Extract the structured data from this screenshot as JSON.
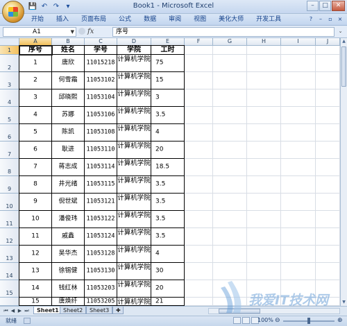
{
  "window": {
    "title": "Book1 - Microsoft Excel",
    "quick_access": [
      "save-icon",
      "undo-icon",
      "redo-icon"
    ],
    "controls": {
      "minimize": "–",
      "maximize": "□",
      "close": "✕"
    }
  },
  "ribbon": {
    "tabs": [
      "开始",
      "插入",
      "页面布局",
      "公式",
      "数据",
      "审阅",
      "视图",
      "美化大师",
      "开发工具"
    ]
  },
  "formula_bar": {
    "name_box": "A1",
    "fx_label": "fx",
    "content": "序号"
  },
  "columns": [
    "A",
    "B",
    "C",
    "D",
    "E",
    "F",
    "G",
    "H",
    "I",
    "J"
  ],
  "row_numbers": [
    "1",
    "2",
    "3",
    "4",
    "5",
    "6",
    "7",
    "8",
    "9",
    "10",
    "11",
    "12",
    "13",
    "14",
    "15"
  ],
  "table": {
    "headers": [
      "序号",
      "姓名",
      "学号",
      "学院",
      "工时"
    ],
    "rows": [
      {
        "no": "1",
        "name": "唐欣",
        "id": "11015218",
        "college": "计算机学院",
        "hours": "75"
      },
      {
        "no": "2",
        "name": "何雪霜",
        "id": "11053102",
        "college": "计算机学院",
        "hours": "15"
      },
      {
        "no": "3",
        "name": "邱晓熙",
        "id": "11053104",
        "college": "计算机学院",
        "hours": "3"
      },
      {
        "no": "4",
        "name": "苏娜",
        "id": "11053106",
        "college": "计算机学院",
        "hours": "3.5"
      },
      {
        "no": "5",
        "name": "陈凯",
        "id": "11053108",
        "college": "计算机学院",
        "hours": "4"
      },
      {
        "no": "6",
        "name": "耿进",
        "id": "11053110",
        "college": "计算机学院",
        "hours": "20"
      },
      {
        "no": "7",
        "name": "蒋志成",
        "id": "11053114",
        "college": "计算机学院",
        "hours": "18.5"
      },
      {
        "no": "8",
        "name": "井光绪",
        "id": "11053115",
        "college": "计算机学院",
        "hours": "3.5"
      },
      {
        "no": "9",
        "name": "倪世斌",
        "id": "11053121",
        "college": "计算机学院",
        "hours": "3.5"
      },
      {
        "no": "10",
        "name": "潘俊玮",
        "id": "11053122",
        "college": "计算机学院",
        "hours": "3.5"
      },
      {
        "no": "11",
        "name": "戚鑫",
        "id": "11053124",
        "college": "计算机学院",
        "hours": "3.5"
      },
      {
        "no": "12",
        "name": "吴华杰",
        "id": "11053128",
        "college": "计算机学院",
        "hours": "4"
      },
      {
        "no": "13",
        "name": "徐锡健",
        "id": "11053130",
        "college": "计算机学院",
        "hours": "30"
      },
      {
        "no": "14",
        "name": "钱红林",
        "id": "11053203",
        "college": "计算机学院",
        "hours": "20"
      },
      {
        "no": "15",
        "name": "唐焕纤",
        "id": "11053205",
        "college": "计算机学院",
        "hours": "21"
      }
    ]
  },
  "sheets": {
    "tabs": [
      "Sheet1",
      "Sheet2",
      "Sheet3"
    ],
    "active": "Sheet1"
  },
  "status": {
    "mode": "就绪",
    "zoom": "100%",
    "zoom_fraction": 0.5
  },
  "watermark": {
    "text": "我爱IT技术网"
  }
}
